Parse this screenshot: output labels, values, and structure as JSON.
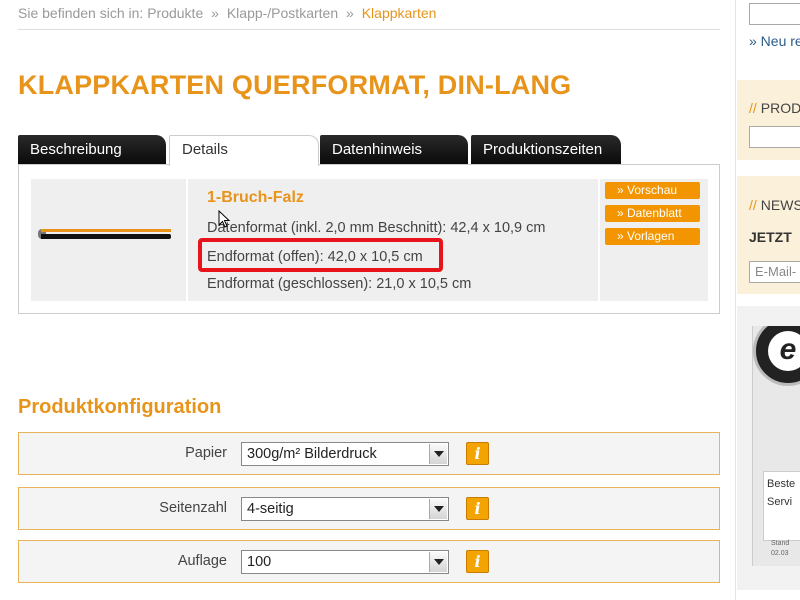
{
  "breadcrumb": {
    "prefix": "Sie befinden sich in:",
    "items": [
      "Produkte",
      "Klapp-/Postkarten"
    ],
    "separator": "»",
    "current": "Klappkarten"
  },
  "page_title": "KLAPPKARTEN QUERFORMAT, DIN-LANG",
  "tabs": [
    {
      "label": "Beschreibung",
      "active": false
    },
    {
      "label": "Details",
      "active": true
    },
    {
      "label": "Datenhinweis",
      "active": false
    },
    {
      "label": "Produktionszeiten",
      "active": false
    }
  ],
  "details": {
    "title": "1-Bruch-Falz",
    "lines": [
      "Datenformat (inkl. 2,0 mm Beschnitt): 42,4 x 10,9 cm",
      "Endformat (offen): 42,0 x 10,5 cm",
      "Endformat (geschlossen): 21,0 x 10,5 cm"
    ],
    "highlighted_line": "Endformat (offen): 42,0 x 10,5 cm",
    "actions": [
      "» Vorschau",
      "» Datenblatt",
      "» Vorlagen"
    ]
  },
  "config": {
    "title": "Produktkonfiguration",
    "rows": [
      {
        "label": "Papier",
        "value": "300g/m² Bilderdruck",
        "info": "i"
      },
      {
        "label": "Seitenzahl",
        "value": "4-seitig",
        "info": "i"
      },
      {
        "label": "Auflage",
        "value": "100",
        "info": "i"
      }
    ]
  },
  "sidebar": {
    "link": "» Neu re",
    "products_heading": "PROD",
    "newsletter_heading": "NEWS",
    "newsletter_strong": "JETZT",
    "email_placeholder": "E-Mail-",
    "trust_text_1": "Beste",
    "trust_text_2": "Servi",
    "trust_small_1": "Stand",
    "trust_small_2": "02.03",
    "trust_seal_letter": "e",
    "heading_slash": "//"
  },
  "colors": {
    "accent": "#e8941a",
    "highlight": "#e8141c",
    "button": "#f29500",
    "tab_dark": "#111111"
  }
}
